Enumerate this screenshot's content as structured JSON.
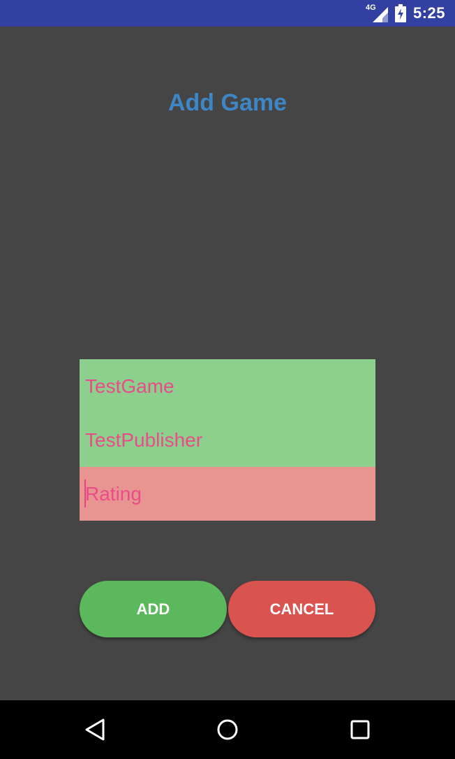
{
  "status_bar": {
    "network": "4G",
    "time": "5:25",
    "icons": [
      "signal-icon",
      "battery-charging-icon"
    ]
  },
  "screen": {
    "title": "Add Game"
  },
  "form": {
    "fields": [
      {
        "name": "game-name-field",
        "value": "TestGame",
        "state": "valid",
        "color": "#8dcf8d"
      },
      {
        "name": "publisher-field",
        "value": "TestPublisher",
        "state": "valid",
        "color": "#8dcf8d"
      },
      {
        "name": "rating-field",
        "value": "",
        "placeholder": "Rating",
        "state": "invalid",
        "color": "#e89592"
      }
    ],
    "text_color": "#ea4c89"
  },
  "buttons": {
    "add_label": "ADD",
    "add_color": "#5cb85c",
    "cancel_label": "CANCEL",
    "cancel_color": "#d9534f"
  },
  "nav_bar": {
    "icons": [
      "back-icon",
      "home-icon",
      "recents-icon"
    ]
  },
  "colors": {
    "status_bar": "#3140a1",
    "background": "#454545",
    "title": "#3d87c6"
  }
}
